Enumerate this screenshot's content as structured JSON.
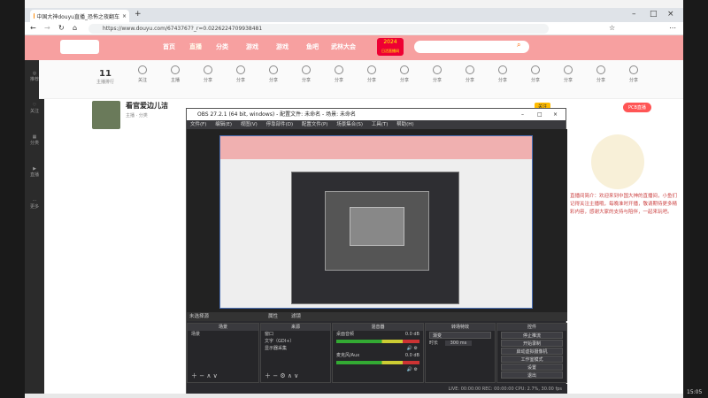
{
  "browser": {
    "tab_title": "中国大神douyu直播_恐怖之夜翻车",
    "url": "https://www.douyu.com/6743767?_r=0.0226224709938481",
    "new_tab": "+"
  },
  "site": {
    "nav": [
      "首页",
      "直播",
      "分类",
      "游戏",
      "游戏",
      "鱼吧",
      "武林大会"
    ],
    "promo": "2024",
    "promo_sub": "日活直播间",
    "cats": [
      "关注",
      "主播",
      "分享",
      "分享",
      "分享",
      "分享",
      "分享",
      "分享",
      "分享",
      "分享",
      "分享",
      "分享",
      "分享",
      "分享",
      "分享",
      "分享"
    ],
    "rank_label": "11",
    "rank_sub": "主播排行",
    "room_title": "看官爱边儿洁",
    "room_meta": "主播  ·  分类",
    "follow": "关注",
    "pcb_btn": "PCB直播",
    "right_text": "直播间简介：欢迎来到中国大神的直播间，小鱼们记得关注主播哦，每晚准时开播，敬请期待更多精彩内容，感谢大家的支持与陪伴，一起来玩吧。",
    "side": [
      "推荐",
      "关注",
      "分类",
      "直播",
      "更多"
    ]
  },
  "obs": {
    "title": "OBS 27.2.1 (64 bit, windows) - 配置文件: 未命名 - 场景: 未命名",
    "menu": [
      "文件(F)",
      "编辑(E)",
      "视图(V)",
      "停靠部件(D)",
      "配置文件(P)",
      "场景集合(S)",
      "工具(T)",
      "帮助(H)"
    ],
    "source_bar": "未选择源",
    "props": "属性",
    "filters": "滤镜",
    "scenes_header": "场景",
    "scene_item": "场景",
    "sources_header": "来源",
    "sources": [
      "窗口",
      "文字（GDI+）",
      "显示器采集"
    ],
    "mixer_header": "混音器",
    "mix": [
      {
        "name": "桌面音频",
        "db": "0.0 dB"
      },
      {
        "name": "麦克风/Aux",
        "db": "0.0 dB"
      }
    ],
    "transitions_header": "转场特效",
    "transition": "渐变",
    "duration_label": "时长",
    "duration": "300 ms",
    "controls_header": "控件",
    "controls": [
      "停止推流",
      "开始录制",
      "启动虚拟摄像机",
      "工作室模式",
      "设置",
      "退出"
    ],
    "status": "LIVE: 00:00:00   REC: 00:00:00   CPU: 2.7%, 30.00 fps"
  },
  "clock": "15:05"
}
